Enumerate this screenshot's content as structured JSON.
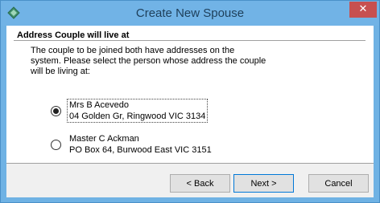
{
  "window": {
    "title": "Create New Spouse",
    "close_glyph": "✕"
  },
  "header": {
    "title": "Address Couple will live at",
    "description": "The couple to be joined both have addresses on the\nsystem.  Please select the person whose address the couple\nwill be living at:"
  },
  "options": [
    {
      "name": "Mrs B Acevedo",
      "address": "04 Golden Gr, Ringwood VIC 3134",
      "selected": true
    },
    {
      "name": "Master C Ackman",
      "address": "PO Box 64, Burwood East VIC 3151",
      "selected": false
    }
  ],
  "buttons": {
    "back": "< Back",
    "next": "Next >",
    "cancel": "Cancel"
  },
  "icons": {
    "app": "app-diamond-icon",
    "close": "close-icon"
  },
  "colors": {
    "titlebar": "#71b3e6",
    "close": "#c75050",
    "default_button_border": "#0078d7"
  }
}
